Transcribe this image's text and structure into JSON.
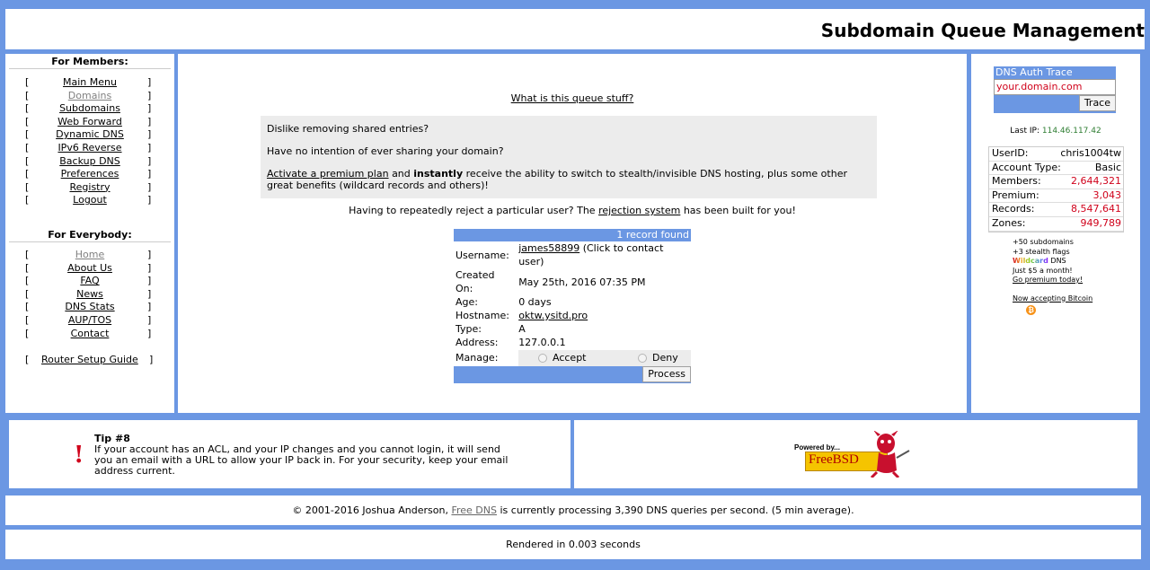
{
  "header": {
    "title": "Subdomain Queue Management"
  },
  "left": {
    "members_title": "For Members:",
    "members": [
      {
        "label": "Main Menu"
      },
      {
        "label": "Domains"
      },
      {
        "label": "Subdomains"
      },
      {
        "label": "Web Forward"
      },
      {
        "label": "Dynamic DNS"
      },
      {
        "label": "IPv6 Reverse"
      },
      {
        "label": "Backup DNS"
      },
      {
        "label": "Preferences"
      },
      {
        "label": "Registry"
      },
      {
        "label": "Logout"
      }
    ],
    "everybody_title": "For Everybody:",
    "everybody": [
      {
        "label": "Home"
      },
      {
        "label": "About Us"
      },
      {
        "label": "FAQ"
      },
      {
        "label": "News"
      },
      {
        "label": "DNS Stats"
      },
      {
        "label": "AUP/TOS"
      },
      {
        "label": "Contact"
      }
    ],
    "router": {
      "label": "Router Setup Guide"
    },
    "bracket_open": "[",
    "bracket_close": "]"
  },
  "main": {
    "queue_link": "What is this queue stuff?",
    "notice": {
      "line1": "Dislike removing shared entries?",
      "line2": "Have no intention of ever sharing your domain?",
      "premium_link": "Activate a premium plan",
      "and": "and",
      "instantly": "instantly",
      "rest": "receive the ability to switch to stealth/invisible DNS hosting, plus some other great benefits (wildcard records and others)!"
    },
    "reject": {
      "before": "Having to repeatedly reject a particular user? The",
      "link": "rejection system",
      "after": "has been built for you!"
    },
    "record": {
      "found": "1 record found",
      "username_label": "Username:",
      "username": "james58899",
      "username_note": "(Click to contact user)",
      "created_label": "Created On:",
      "created": "May 25th, 2016 07:35 PM",
      "age_label": "Age:",
      "age": "0 days",
      "hostname_label": "Hostname:",
      "hostname": "oktw.ysitd.pro",
      "type_label": "Type:",
      "type": "A",
      "address_label": "Address:",
      "address": "127.0.0.1",
      "manage_label": "Manage:",
      "accept": "Accept",
      "deny": "Deny",
      "process": "Process"
    }
  },
  "right": {
    "trace_title": "DNS Auth Trace",
    "trace_value": "your.domain.com",
    "trace_button": "Trace",
    "last_ip_label": "Last IP:",
    "last_ip": "114.46.117.42",
    "stats": [
      {
        "k": "UserID:",
        "v": "chris1004tw"
      },
      {
        "k": "Account Type:",
        "v": "Basic"
      },
      {
        "k": "Members:",
        "v": "2,644,321"
      },
      {
        "k": "Premium:",
        "v": "3,043"
      },
      {
        "k": "Records:",
        "v": "8,547,641"
      },
      {
        "k": "Zones:",
        "v": "949,789"
      }
    ],
    "promo1": "+50 subdomains",
    "promo2": "+3 stealth flags",
    "wildcard": "Wildcard",
    "dns": "DNS",
    "promo4": "Just $5 a month!",
    "premium_link": "Go premium today!",
    "bitcoin_link": "Now accepting Bitcoin"
  },
  "tip": {
    "title": "Tip #8",
    "body": "If your account has an ACL, and your IP changes and you cannot login, it will send you an email with a URL to allow your IP back in. For your security, keep your email address current."
  },
  "powered": {
    "powered_by": "Powered by...",
    "logo": "FreeBSD"
  },
  "footer": {
    "copyright": "© 2001-2016 Joshua Anderson,",
    "free_dns": "Free DNS",
    "rest": "is currently processing 3,390 DNS queries per second. (5 min average).",
    "rendered": "Rendered in 0.003 seconds"
  },
  "colors": {
    "background": "#6b97e3",
    "header_bar": "#6b97e3",
    "red_stats": "#d0021b",
    "ip_green": "#2e7d32"
  }
}
